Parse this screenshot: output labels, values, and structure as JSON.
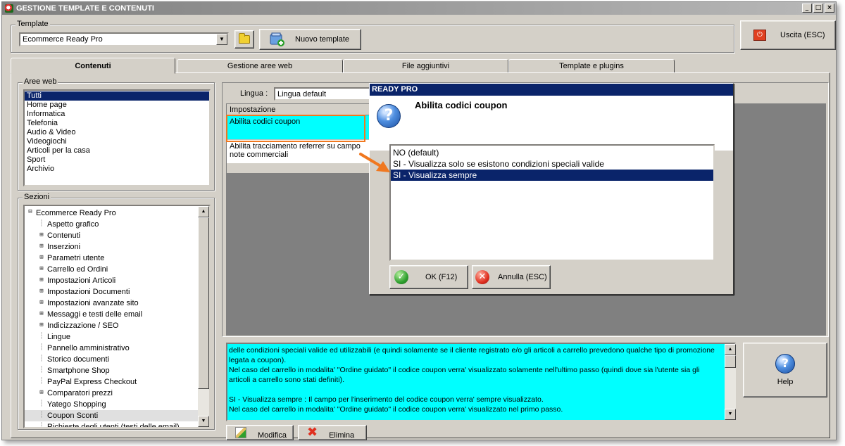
{
  "window": {
    "title": "GESTIONE TEMPLATE E CONTENUTI",
    "min": "_",
    "max": "□",
    "close": "×"
  },
  "template": {
    "group_label": "Template",
    "selected": "Ecommerce Ready Pro",
    "new_button": "Nuovo template"
  },
  "exit_button": "Uscita (ESC)",
  "tabs": [
    "Contenuti",
    "Gestione aree web",
    "File aggiuntivi",
    "Template e plugins"
  ],
  "aree_web": {
    "label": "Aree web",
    "items": [
      "Tutti",
      "Home page",
      "Informatica",
      "Telefonia",
      "Audio & Video",
      "Videogiochi",
      "Articoli per la casa",
      "Sport",
      "Archivio"
    ]
  },
  "sezioni": {
    "label": "Sezioni",
    "root": "Ecommerce Ready Pro",
    "items": [
      {
        "label": "Aspetto grafico",
        "expandable": false
      },
      {
        "label": "Contenuti",
        "expandable": true
      },
      {
        "label": "Inserzioni",
        "expandable": true
      },
      {
        "label": "Parametri utente",
        "expandable": true
      },
      {
        "label": "Carrello ed Ordini",
        "expandable": true
      },
      {
        "label": "Impostazioni Articoli",
        "expandable": true
      },
      {
        "label": "Impostazioni Documenti",
        "expandable": true
      },
      {
        "label": "Impostazioni avanzate sito",
        "expandable": true
      },
      {
        "label": "Messaggi e testi delle email",
        "expandable": true
      },
      {
        "label": "Indicizzazione / SEO",
        "expandable": true
      },
      {
        "label": "Lingue",
        "expandable": false
      },
      {
        "label": "Pannello amministrativo",
        "expandable": false
      },
      {
        "label": "Storico documenti",
        "expandable": false
      },
      {
        "label": "Smartphone Shop",
        "expandable": false
      },
      {
        "label": "PayPal Express Checkout",
        "expandable": false
      },
      {
        "label": "Comparatori prezzi",
        "expandable": true
      },
      {
        "label": "Yatego Shopping",
        "expandable": false
      },
      {
        "label": "Coupon Sconti",
        "expandable": false
      },
      {
        "label": "Richieste degli utenti (testi delle email)",
        "expandable": false
      }
    ]
  },
  "lingua": {
    "label": "Lingua :",
    "value": "Lingua default"
  },
  "settings_grid": {
    "header": "Impostazione",
    "rows": [
      "Abilita codici coupon",
      "Abilita tracciamento referrer su campo note commerciali"
    ]
  },
  "description": {
    "lines": [
      "delle condizioni speciali valide ed utilizzabili (e quindi solamente se il cliente registrato e/o gli articoli a carrello prevedono qualche tipo di promozione legata a coupon).",
      "Nel caso del carrello in modalita' \"Ordine guidato\" il codice coupon verra' visualizzato solamente nell'ultimo passo (quindi dove sia l'utente sia gli articoli a carrello sono stati definiti).",
      "",
      "SI - Visualizza sempre : Il campo per l'inserimento del codice coupon verra' sempre visualizzato.",
      "Nel caso del carrello in modalita' \"Ordine guidato\" il codice coupon verra' visualizzato nel primo passo."
    ]
  },
  "help_button": "Help",
  "bottom_buttons": {
    "modify": "Modifica",
    "delete": "Elimina"
  },
  "dialog": {
    "title": "READY PRO",
    "question": "Abilita codici coupon",
    "options": [
      "NO (default)",
      "SI - Visualizza solo se esistono condizioni speciali valide",
      "SI - Visualizza sempre"
    ],
    "selected_index": 2,
    "ok": "OK (F12)",
    "cancel": "Annulla (ESC)"
  },
  "colors": {
    "selection": "#0a246a",
    "highlight": "#00ffff",
    "annotation": "#f07820"
  }
}
